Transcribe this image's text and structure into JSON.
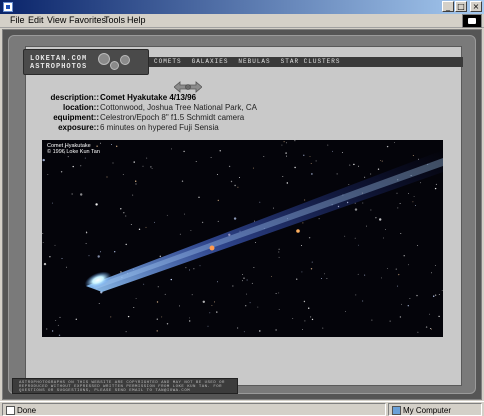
{
  "browser": {
    "menu": [
      "File",
      "Edit",
      "View",
      "Favorites",
      "Tools",
      "Help"
    ],
    "menu_accel": [
      "F",
      "E",
      "V",
      "a",
      "T",
      "H"
    ],
    "window_buttons": [
      "_",
      "□",
      "×"
    ],
    "status": "Done",
    "zone": "My Computer"
  },
  "site": {
    "logo_line1": "LOKETAN.COM",
    "logo_line2": "ASTROPHOTOS",
    "nav": [
      "COMETS",
      "GALAXIES",
      "NEBULAS",
      "STAR CLUSTERS"
    ],
    "copyright": "ASTROPHOTOGRAPHS ON THIS WEBSITE ARE COPYRIGHTED AND MAY NOT BE USED OR REPRODUCED WITHOUT EXPRESSED WRITTEN PERMISSION FROM LOKE KUN TAN. FOR QUESTIONS OR SUGGESTIONS, PLEASE SEND EMAIL TO TAN@IOWA.COM"
  },
  "photo_info": {
    "description_label": "description::",
    "description": "Comet Hyakutake 4/13/96",
    "location_label": "location::",
    "location": "Cottonwood, Joshua Tree National Park, CA",
    "equipment_label": "equipment::",
    "equipment": "Celestron/Epoch 8\" f1.5 Schmidt camera",
    "exposure_label": "exposure::",
    "exposure": "6 minutes on hypered Fuji Sensia"
  },
  "photo": {
    "caption_line1": "Comet Hyakutake",
    "caption_line2": "© 1996 Loke Kun Tan",
    "alt": "Comet Hyakutake"
  },
  "icons": {
    "back_forward": "double-arrow-icon",
    "page": "ie-page-icon",
    "computer": "my-computer-icon"
  }
}
